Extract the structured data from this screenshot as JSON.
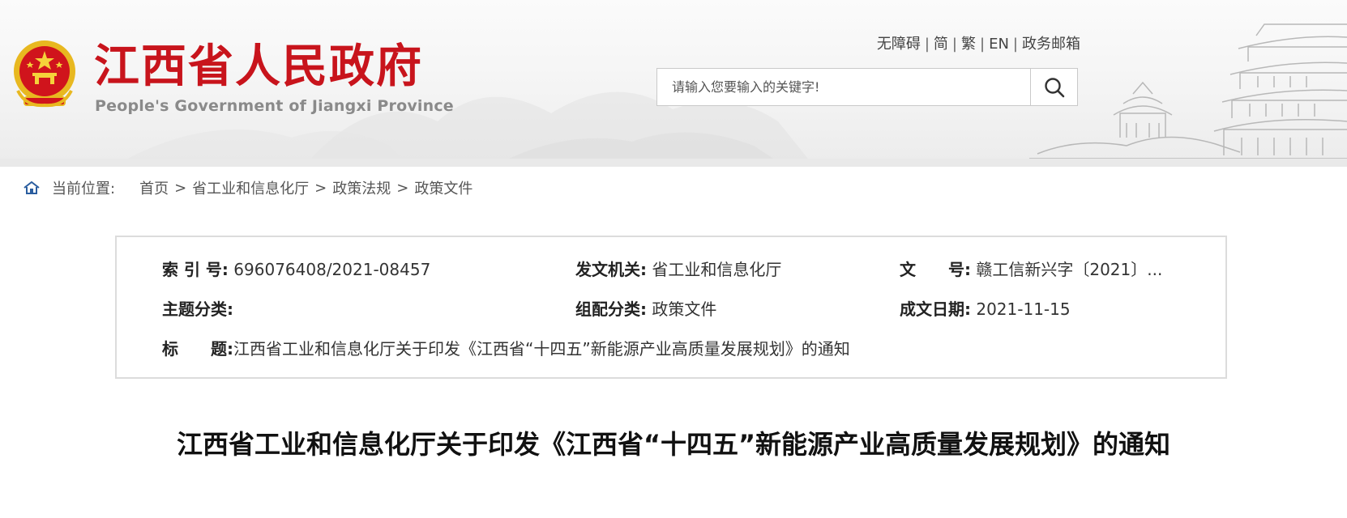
{
  "header": {
    "title": "江西省人民政府",
    "subtitle": "People's Government of Jiangxi Province",
    "links": [
      "无障碍",
      "简",
      "繁",
      "EN",
      "政务邮箱"
    ],
    "link_separator": "|",
    "search": {
      "placeholder": "请输入您要输入的关键字!",
      "icon": "search-icon"
    },
    "colors": {
      "title": "#c8141c",
      "emblem_red": "#d0141c",
      "emblem_gold": "#e8b820"
    }
  },
  "breadcrumb": {
    "icon": "home-icon",
    "label": "当前位置:",
    "items": [
      "首页",
      "省工业和信息化厅",
      "政策法规",
      "政策文件"
    ],
    "separator": ">"
  },
  "info": {
    "index_no": {
      "key": "索 引 号:",
      "value": "696076408/2021-08457"
    },
    "issuer": {
      "key": "发文机关:",
      "value": "省工业和信息化厅"
    },
    "doc_no": {
      "key": "文　　号:",
      "value": "赣工信新兴字〔2021〕..."
    },
    "theme": {
      "key": "主题分类:",
      "value": ""
    },
    "category": {
      "key": "组配分类:",
      "value": "政策文件"
    },
    "date": {
      "key": "成文日期:",
      "value": "2021-11-15"
    },
    "title": {
      "key": "标　　题:",
      "value": "江西省工业和信息化厅关于印发《江西省“十四五”新能源产业高质量发展规划》的通知"
    }
  },
  "article": {
    "title": "江西省工业和信息化厅关于印发《江西省“十四五”新能源产业高质量发展规划》的通知"
  }
}
